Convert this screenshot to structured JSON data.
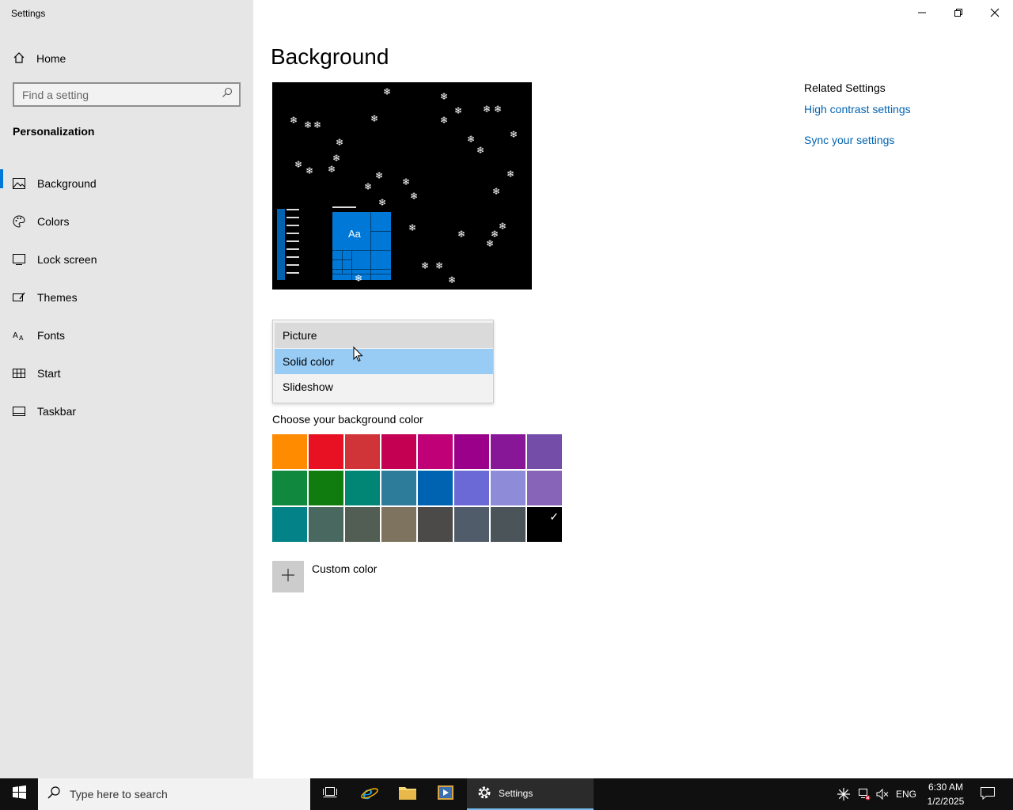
{
  "window": {
    "title": "Settings",
    "controls": [
      "minimize",
      "maximize",
      "close"
    ]
  },
  "sidebar": {
    "home_label": "Home",
    "search_placeholder": "Find a setting",
    "section_title": "Personalization",
    "items": [
      {
        "label": "Background",
        "icon": "picture-icon",
        "active": true
      },
      {
        "label": "Colors",
        "icon": "palette-icon",
        "active": false
      },
      {
        "label": "Lock screen",
        "icon": "lock-screen-icon",
        "active": false
      },
      {
        "label": "Themes",
        "icon": "themes-icon",
        "active": false
      },
      {
        "label": "Fonts",
        "icon": "fonts-icon",
        "active": false
      },
      {
        "label": "Start",
        "icon": "start-icon",
        "active": false
      },
      {
        "label": "Taskbar",
        "icon": "taskbar-icon",
        "active": false
      }
    ]
  },
  "main": {
    "title": "Background",
    "preview_tile_text": "Aa",
    "dropdown": {
      "options": [
        "Picture",
        "Solid color",
        "Slideshow"
      ],
      "hovered": "Picture",
      "selected": "Solid color"
    },
    "choose_color_label": "Choose your background color",
    "colors": [
      "#ff8c00",
      "#e81123",
      "#d13438",
      "#c30052",
      "#bf0077",
      "#9a0089",
      "#881798",
      "#744da9",
      "#10893e",
      "#107c10",
      "#018574",
      "#2d7d9a",
      "#0063b1",
      "#6b69d6",
      "#8e8cd8",
      "#8764b8",
      "#038387",
      "#486860",
      "#525e54",
      "#7e735f",
      "#4c4a48",
      "#515c6b",
      "#4a5459",
      "#000000"
    ],
    "selected_color": "#000000",
    "custom_color_label": "Custom color"
  },
  "related": {
    "title": "Related Settings",
    "links": [
      "High contrast settings",
      "Sync your settings"
    ]
  },
  "taskbar": {
    "search_placeholder": "Type here to search",
    "active_app_label": "Settings",
    "language": "ENG",
    "time": "6:30 AM",
    "date": "1/2/2025"
  }
}
